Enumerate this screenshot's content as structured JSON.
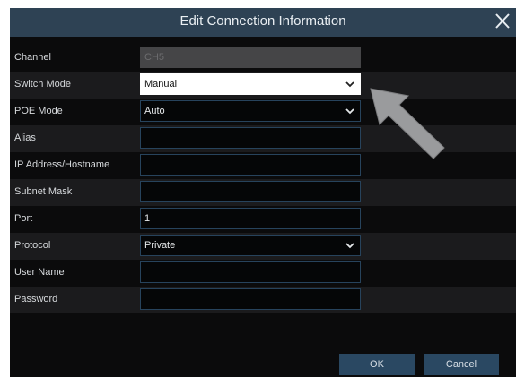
{
  "dialog": {
    "title": "Edit Connection Information",
    "fields": [
      {
        "label": "Channel",
        "value": "CH5",
        "kind": "text"
      },
      {
        "label": "Switch Mode",
        "value": "Manual",
        "kind": "select"
      },
      {
        "label": "POE Mode",
        "value": "Auto",
        "kind": "select"
      },
      {
        "label": "Alias",
        "value": "",
        "kind": "text"
      },
      {
        "label": "IP Address/Hostname",
        "value": "",
        "kind": "text"
      },
      {
        "label": "Subnet Mask",
        "value": "",
        "kind": "text"
      },
      {
        "label": "Port",
        "value": "1",
        "kind": "text"
      },
      {
        "label": "Protocol",
        "value": "Private",
        "kind": "select"
      },
      {
        "label": "User Name",
        "value": "",
        "kind": "text"
      },
      {
        "label": "Password",
        "value": "",
        "kind": "text"
      }
    ],
    "buttons": {
      "ok": "OK",
      "cancel": "Cancel"
    }
  },
  "colors": {
    "titlebar": "#2e4254",
    "background": "#0b0b0c",
    "button": "#2a4862",
    "pointer_arrow": "#9a9b9d"
  },
  "icons": [
    "close-icon",
    "chevron-down-icon",
    "pointer-arrow-icon"
  ]
}
